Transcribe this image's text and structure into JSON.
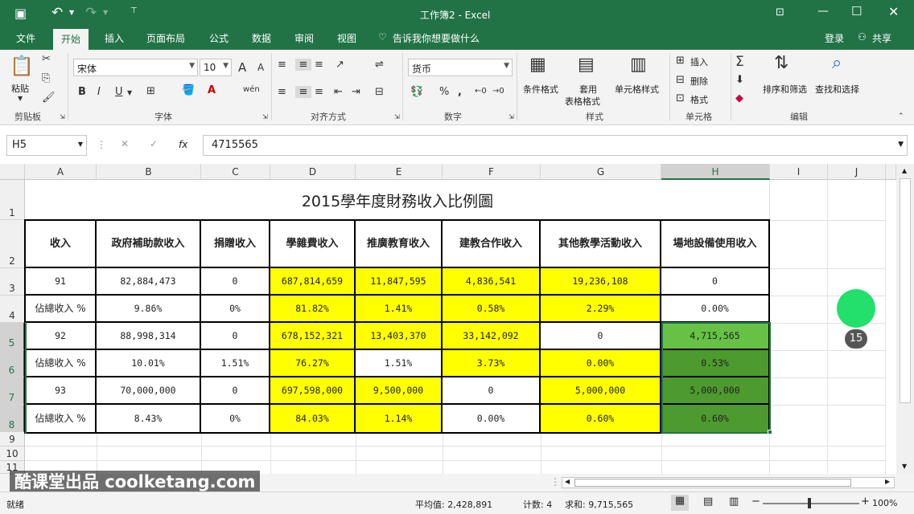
{
  "window": {
    "title": "工作簿2 - Excel"
  },
  "menu": {
    "items": [
      "文件",
      "开始",
      "插入",
      "页面布局",
      "公式",
      "数据",
      "审阅",
      "视图"
    ],
    "tell": "告诉我你想要做什么",
    "login": "登录",
    "share": "共享"
  },
  "ribbon": {
    "clipboard": {
      "paste": "粘贴",
      "group": "剪贴板"
    },
    "font": {
      "name": "宋体",
      "size": "10",
      "group": "字体",
      "bold": "B",
      "italic": "I",
      "underline": "U",
      "wen": "wén",
      "big_a": "A",
      "small_a": "A"
    },
    "align": {
      "group": "对齐方式"
    },
    "number": {
      "format": "货币",
      "group": "数字",
      "percent": "%"
    },
    "styles": {
      "cond": "条件格式",
      "table1": "套用",
      "table2": "表格格式",
      "cell": "单元格样式",
      "group": "样式"
    },
    "cells": {
      "insert": "插入",
      "delete": "删除",
      "format": "格式",
      "group": "单元格"
    },
    "edit": {
      "sort": "排序和筛选",
      "find": "查找和选择",
      "group": "编辑",
      "sigma": "Σ"
    }
  },
  "formula": {
    "namebox": "H5",
    "value": "4715565",
    "fx": "fx"
  },
  "columns": [
    "A",
    "B",
    "C",
    "D",
    "E",
    "F",
    "G",
    "H",
    "I",
    "J"
  ],
  "rows": [
    "1",
    "2",
    "3",
    "4",
    "5",
    "6",
    "7",
    "8",
    "9",
    "10",
    "11"
  ],
  "sheet": {
    "title": "2015學年度財務收入比例圖",
    "headers": [
      "收入",
      "政府補助款收入",
      "捐贈收入",
      "學雜費收入",
      "推廣教育收入",
      "建教合作收入",
      "其他教學活動收入",
      "場地設備使用收入"
    ],
    "data": [
      [
        "91",
        "82,884,473",
        "0",
        "687,814,659",
        "11,847,595",
        "4,836,541",
        "19,236,108",
        "0"
      ],
      [
        "佔總收入 %",
        "9.86%",
        "0%",
        "81.82%",
        "1.41%",
        "0.58%",
        "2.29%",
        "0.00%"
      ],
      [
        "92",
        "88,998,314",
        "0",
        "678,152,321",
        "13,403,370",
        "33,142,092",
        "0",
        "4,715,565"
      ],
      [
        "佔總收入 %",
        "10.01%",
        "1.51%",
        "76.27%",
        "1.51%",
        "3.73%",
        "0.00%",
        "0.53%"
      ],
      [
        "93",
        "70,000,000",
        "0",
        "697,598,000",
        "9,500,000",
        "0",
        "5,000,000",
        "5,000,000"
      ],
      [
        "佔總收入 %",
        "8.43%",
        "0%",
        "84.03%",
        "1.14%",
        "0.00%",
        "0.60%",
        "0.60%"
      ]
    ]
  },
  "overlay": {
    "badge": "15",
    "watermark": "酷课堂出品 coolketang.com"
  },
  "status": {
    "ready": "就绪",
    "average": "平均值: 2,428,891",
    "count": "计数: 4",
    "sum": "求和: 9,715,565",
    "zoom": "100%"
  },
  "colors": {
    "excel_green": "#217346",
    "highlight_yellow": "#ffff00",
    "sel_green_light": "#66c144",
    "sel_green_dark": "#4d9a2e",
    "badge_green": "#22e06b"
  }
}
